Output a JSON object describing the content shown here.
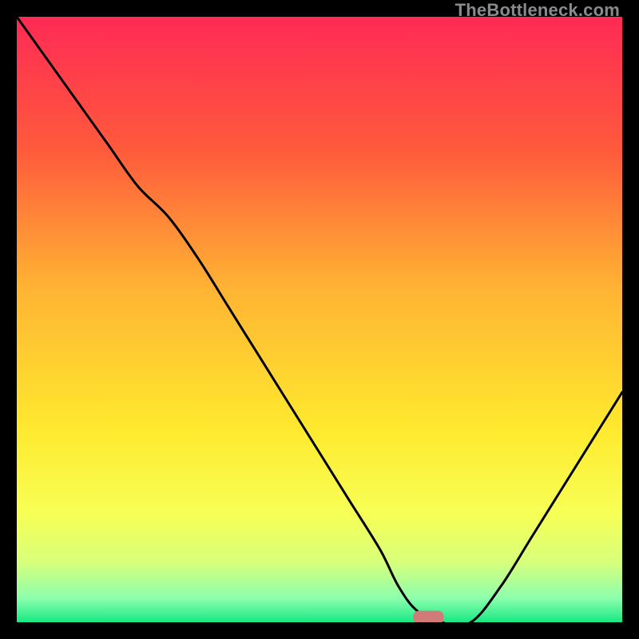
{
  "watermark": "TheBottleneck.com",
  "chart_data": {
    "type": "line",
    "title": "",
    "xlabel": "",
    "ylabel": "",
    "xlim": [
      0,
      100
    ],
    "ylim": [
      0,
      100
    ],
    "grid": false,
    "series": [
      {
        "name": "bottleneck-curve",
        "x": [
          0,
          5,
          10,
          15,
          20,
          25,
          30,
          35,
          40,
          45,
          50,
          55,
          60,
          63,
          66,
          70,
          75,
          80,
          85,
          90,
          95,
          100
        ],
        "y": [
          100,
          93,
          86,
          79,
          72,
          67,
          60,
          52,
          44,
          36,
          28,
          20,
          12,
          6,
          2,
          0,
          0,
          6,
          14,
          22,
          30,
          38
        ]
      }
    ],
    "marker": {
      "name": "current-config",
      "x": 68,
      "y": 0.8,
      "color": "#d07a7a",
      "width_pct": 5,
      "height_pct": 2.2
    },
    "gradient_stops": [
      {
        "pct": 0,
        "color": "#ff2a55"
      },
      {
        "pct": 22,
        "color": "#ff5a3c"
      },
      {
        "pct": 45,
        "color": "#ffb433"
      },
      {
        "pct": 68,
        "color": "#ffe92e"
      },
      {
        "pct": 82,
        "color": "#f7ff55"
      },
      {
        "pct": 90,
        "color": "#d8ff7a"
      },
      {
        "pct": 96,
        "color": "#8dffad"
      },
      {
        "pct": 100,
        "color": "#17e884"
      }
    ]
  }
}
